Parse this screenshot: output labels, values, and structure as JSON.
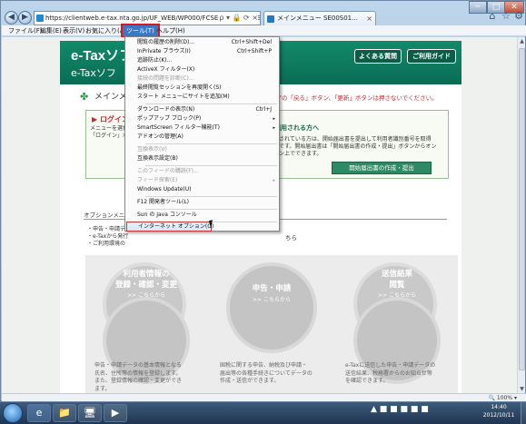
{
  "browser": {
    "address": "https://clientweb.e-tax.nta.go.jp/UF_WEB/WP000/FCSE00001/SE00S010SU...",
    "tab_active": "メインメニュー SE00S01...",
    "tab_close": "×",
    "win_controls": [
      "─",
      "□",
      "✕"
    ],
    "nav_back": "◀",
    "nav_forward": "▶",
    "address_icons": "ρ ▾ 🔒 ⟳ ×",
    "toolbar_icons": [
      "⌂",
      "☆",
      "⚙"
    ]
  },
  "menubar": {
    "file": "ファイル(F)",
    "edit": "編集(E)",
    "view": "表示(V)",
    "favorites": "お気に入り(A)",
    "tools": "ツール(T)",
    "help": "ヘルプ(H)"
  },
  "tools_menu": {
    "items": [
      {
        "label": "閲覧の履歴の削除(D)...",
        "shortcut": "Ctrl+Shift+Del"
      },
      {
        "label": "InPrivate ブラウズ(I)",
        "shortcut": "Ctrl+Shift+P"
      },
      {
        "label": "追跡防止(K)..."
      },
      {
        "label": "ActiveX フィルター(X)"
      },
      {
        "label": "接続の問題を診断(C)...",
        "disabled": true
      },
      {
        "label": "最終閲覧セッションを再度開く(S)"
      },
      {
        "label": "スタート メニューにサイトを追加(M)"
      },
      {
        "label": "ダウンロードの表示(N)",
        "shortcut": "Ctrl+J"
      },
      {
        "label": "ポップアップ ブロック(P)",
        "submenu": "▸"
      },
      {
        "label": "SmartScreen フィルター機能(T)",
        "submenu": "▸"
      },
      {
        "label": "アドオンの管理(A)"
      },
      {
        "label": "互換表示(V)",
        "disabled": true
      },
      {
        "label": "互換表示設定(B)"
      },
      {
        "label": "このフィードの購読(F)...",
        "disabled": true
      },
      {
        "label": "フィード探索(E)",
        "disabled": true,
        "submenu": "▸"
      },
      {
        "label": "Windows Update(U)"
      },
      {
        "label": "F12 開発者ツール(L)"
      },
      {
        "label": "Sun の Java コンソール"
      },
      {
        "label": "インターネット オプション(O)"
      }
    ]
  },
  "page": {
    "logo": "e-Taxソフト",
    "subtitle": "e-Taxソフ",
    "faq_button": "よくある質問",
    "guide_button": "ご利用ガイド",
    "title": "メインメ",
    "warning": "は、ブラウザの「戻る」ボタン、「更新」ボタンは押さないでください。",
    "login_title": "ログイン",
    "login_text": "メニューを選択\n「ログイン」ボタン",
    "login_right_title": "を利用される方へ",
    "login_right_text": "出力されている方は、開始届出書を提出して利用者識別番号を取得\n可能です。開始届出書は「開始届出書の作成・提出」ボタンからオン\nライン上でできます。",
    "start_button": "開始届出書の作成・提出",
    "options_label": "オプションメニュー",
    "bullets": "・申告・申請データ\n・e-Taxから発行\n・ご利用環境の",
    "bullet_link": "ちら",
    "cards": [
      {
        "title": "利用者情報の",
        "title2": "登録・確認・変更",
        "sub": ">> こちらから",
        "desc": "申告・申請データの基本情報となる\n氏名、住所等の情報を登録します。\nまた、登録情報の確認・変更ができ\nます。"
      },
      {
        "title": "申告・申請",
        "title2": "",
        "sub": ">> こちらから",
        "desc": "国税に関する申告、納税及び申請・\n届出等の各種手続きについてデータの\n作成・送信ができます。"
      },
      {
        "title": "送信結果",
        "title2": "閲覧",
        "sub": ">> こちらから",
        "desc": "e-Taxに送信した申告・申請データの\n送信結果、税務署からのお知らせ等\nを確認できます。"
      }
    ],
    "zoom": "🔍 100% ▾"
  },
  "taskbar": {
    "clock_time": "14:40",
    "clock_date": "2012/10/11",
    "tray": "▲ ■ ■ ■ ■ ■",
    "apps": [
      "e",
      "📁",
      "🖥",
      "▶"
    ]
  }
}
